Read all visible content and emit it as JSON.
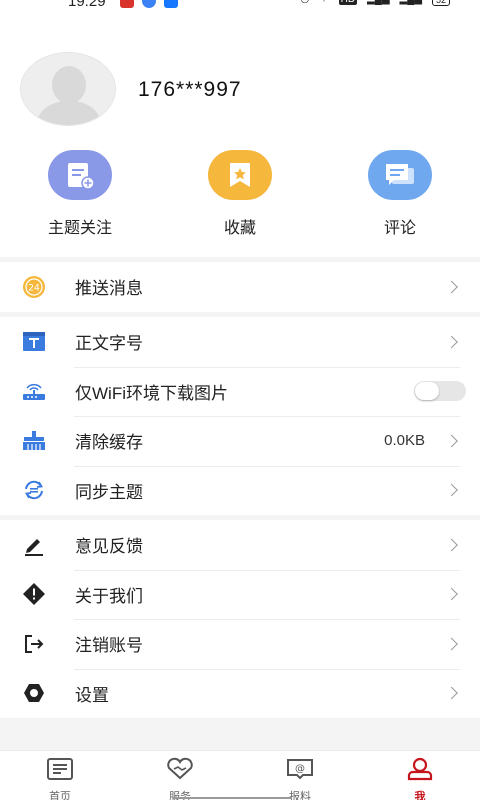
{
  "status_bar": {
    "time": "19:29",
    "battery": "52"
  },
  "profile": {
    "username": "176***997"
  },
  "quick_actions": [
    {
      "label": "主题关注",
      "icon": "topic-follow-icon",
      "color": "#8a98e8"
    },
    {
      "label": "收藏",
      "icon": "favorites-icon",
      "color": "#f5b73c"
    },
    {
      "label": "评论",
      "icon": "comment-icon",
      "color": "#6fa8ee"
    }
  ],
  "menu": {
    "push": {
      "label": "推送消息"
    },
    "font_size": {
      "label": "正文字号"
    },
    "wifi_only": {
      "label": "仅WiFi环境下载图片",
      "enabled": false
    },
    "clear_cache": {
      "label": "清除缓存",
      "value": "0.0KB"
    },
    "sync_topics": {
      "label": "同步主题"
    },
    "feedback": {
      "label": "意见反馈"
    },
    "about": {
      "label": "关于我们"
    },
    "cancel_account": {
      "label": "注销账号"
    },
    "settings": {
      "label": "设置"
    }
  },
  "tabbar": {
    "items": [
      {
        "label": "首页",
        "icon": "home-news-icon"
      },
      {
        "label": "服务",
        "icon": "service-heart-icon"
      },
      {
        "label": "报料",
        "icon": "report-icon"
      },
      {
        "label": "我",
        "icon": "profile-icon"
      }
    ],
    "active_color": "#c4161c"
  }
}
